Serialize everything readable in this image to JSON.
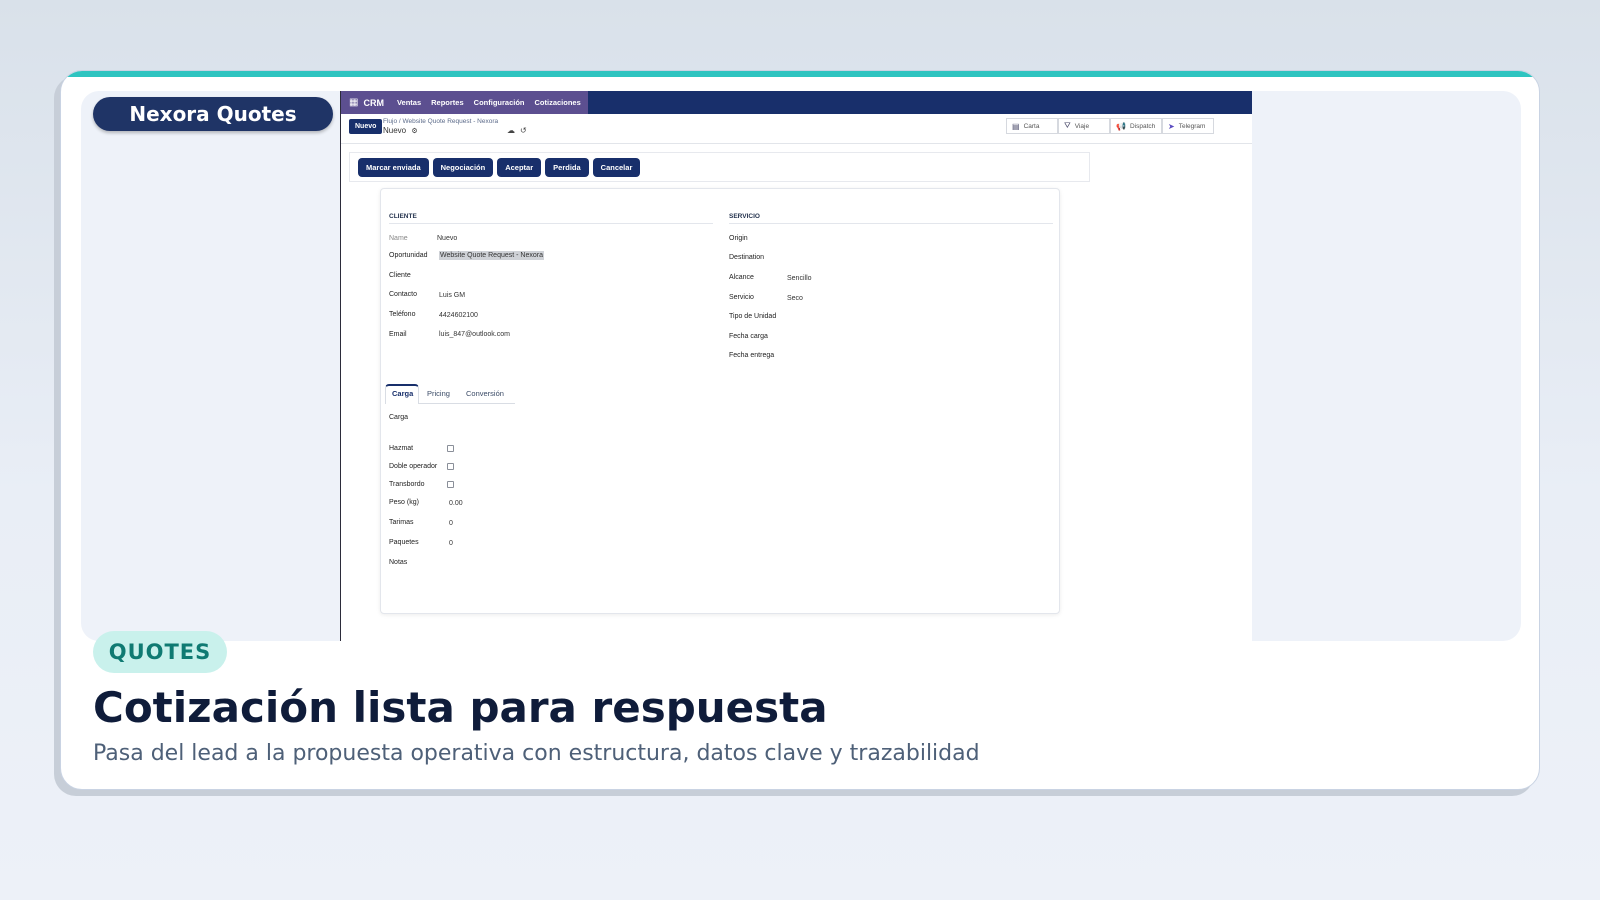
{
  "brand": {
    "name": "Nexora Quotes"
  },
  "colors": {
    "accent": "#2ec4c0",
    "navy": "#182f6b",
    "badge_bg": "#c9f1ec",
    "badge_text": "#0f7a72"
  },
  "topbar": {
    "apps_icon": "apps-grid-icon",
    "app": "CRM",
    "menu": [
      "Ventas",
      "Reportes",
      "Configuración",
      "Cotizaciones"
    ]
  },
  "control_panel": {
    "new_button": "Nuevo",
    "breadcrumb": "Flujo  /  Website Quote Request - Nexora",
    "record_title": "Nuevo",
    "gear_icon": "gear-icon",
    "actions": [
      {
        "label": "Carta",
        "icon": "document-icon"
      },
      {
        "label": "Viaje",
        "icon": "road-icon"
      },
      {
        "label": "Dispatch",
        "icon": "megaphone-icon"
      },
      {
        "label": "Telegram",
        "icon": "telegram-icon"
      }
    ]
  },
  "status_buttons": [
    "Marcar enviada",
    "Negociación",
    "Aceptar",
    "Perdida",
    "Cancelar"
  ],
  "cliente": {
    "title": "CLIENTE",
    "fields": [
      {
        "label": "Name",
        "value": "Nuevo"
      },
      {
        "label": "Oportunidad",
        "value": "Website Quote Request - Nexora"
      },
      {
        "label": "Cliente",
        "value": ""
      },
      {
        "label": "Contacto",
        "value": "Luis GM"
      },
      {
        "label": "Teléfono",
        "value": "4424602100"
      },
      {
        "label": "Email",
        "value": "luis_847@outlook.com"
      }
    ]
  },
  "servicio": {
    "title": "SERVICIO",
    "fields": [
      {
        "label": "Origin",
        "value": ""
      },
      {
        "label": "Destination",
        "value": ""
      },
      {
        "label": "Alcance",
        "value": "Sencillo"
      },
      {
        "label": "Servicio",
        "value": "Seco"
      },
      {
        "label": "Tipo de Unidad",
        "value": ""
      },
      {
        "label": "Fecha carga",
        "value": ""
      },
      {
        "label": "Fecha entrega",
        "value": ""
      }
    ]
  },
  "tabs": [
    "Carga",
    "Pricing",
    "Conversión"
  ],
  "carga": {
    "section_label": "Carga",
    "checkboxes": [
      {
        "label": "Hazmat",
        "checked": false
      },
      {
        "label": "Doble operador",
        "checked": false
      },
      {
        "label": "Transbordo",
        "checked": false
      }
    ],
    "fields": [
      {
        "label": "Peso (kg)",
        "value": "0.00"
      },
      {
        "label": "Tarimas",
        "value": "0"
      },
      {
        "label": "Paquetes",
        "value": "0"
      },
      {
        "label": "Notas",
        "value": ""
      }
    ]
  },
  "footer": {
    "badge": "QUOTES",
    "title": "Cotización lista para respuesta",
    "subtitle": "Pasa del lead a la propuesta operativa con estructura, datos clave y trazabilidad"
  }
}
